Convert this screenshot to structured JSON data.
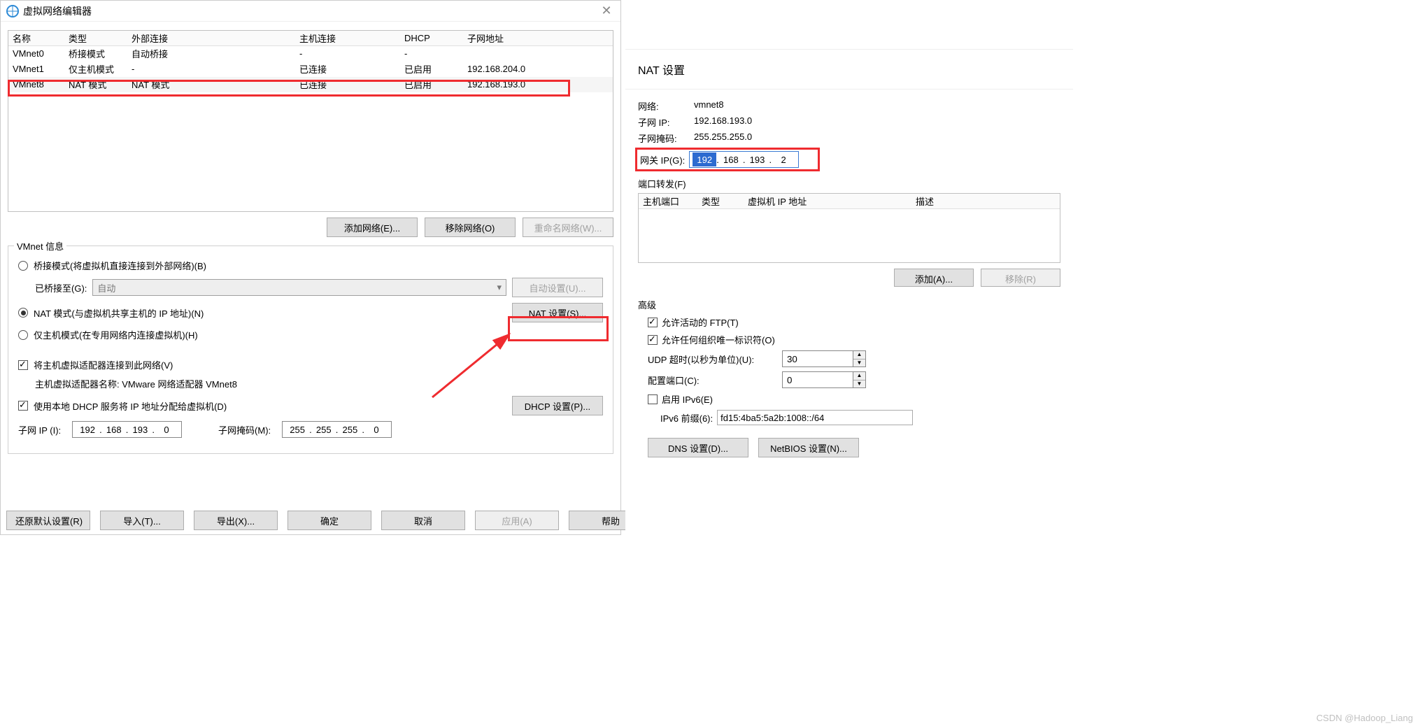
{
  "vne": {
    "title": "虚拟网络编辑器",
    "cols": {
      "name": "名称",
      "type": "类型",
      "ext": "外部连接",
      "host": "主机连接",
      "dhcp": "DHCP",
      "sub": "子网地址"
    },
    "rows": [
      {
        "name": "VMnet0",
        "type": "桥接模式",
        "ext": "自动桥接",
        "host": "-",
        "dhcp": "-",
        "sub": ""
      },
      {
        "name": "VMnet1",
        "type": "仅主机模式",
        "ext": "-",
        "host": "已连接",
        "dhcp": "已启用",
        "sub": "192.168.204.0"
      },
      {
        "name": "VMnet8",
        "type": "NAT 模式",
        "ext": "NAT 模式",
        "host": "已连接",
        "dhcp": "已启用",
        "sub": "192.168.193.0"
      }
    ],
    "btns": {
      "add": "添加网络(E)...",
      "remove": "移除网络(O)",
      "rename": "重命名网络(W)..."
    },
    "fs_title": "VMnet 信息",
    "mode_bridge": "桥接模式(将虚拟机直接连接到外部网络)(B)",
    "bridged_to_label": "已桥接至(G):",
    "bridged_to_value": "自动",
    "auto_set": "自动设置(U)...",
    "mode_nat": "NAT 模式(与虚拟机共享主机的 IP 地址)(N)",
    "nat_set": "NAT 设置(S)...",
    "mode_host": "仅主机模式(在专用网络内连接虚拟机)(H)",
    "chk_hostadapter": "将主机虚拟适配器连接到此网络(V)",
    "adapter_name": "主机虚拟适配器名称: VMware 网络适配器 VMnet8",
    "chk_dhcp": "使用本地 DHCP 服务将 IP 地址分配给虚拟机(D)",
    "dhcp_set": "DHCP 设置(P)...",
    "subnet_ip_label": "子网 IP (I):",
    "subnet_ip": [
      "192",
      "168",
      "193",
      "0"
    ],
    "subnet_mask_label": "子网掩码(M):",
    "subnet_mask": [
      "255",
      "255",
      "255",
      "0"
    ],
    "bottom": {
      "restore": "还原默认设置(R)",
      "import": "导入(T)...",
      "export": "导出(X)...",
      "ok": "确定",
      "cancel": "取消",
      "apply": "应用(A)",
      "help": "帮助"
    }
  },
  "nat": {
    "title": "NAT 设置",
    "kv": {
      "net_l": "网络:",
      "net_v": "vmnet8",
      "sub_l": "子网 IP:",
      "sub_v": "192.168.193.0",
      "mask_l": "子网掩码:",
      "mask_v": "255.255.255.0"
    },
    "gw_label": "网关 IP(G):",
    "gw": [
      "192",
      "168",
      "193",
      "2"
    ],
    "pf_title": "端口转发(F)",
    "pf_cols": {
      "hp": "主机端口",
      "type": "类型",
      "vip": "虚拟机 IP 地址",
      "desc": "描述"
    },
    "pf_btns": {
      "add": "添加(A)...",
      "remove": "移除(R)"
    },
    "adv_title": "高级",
    "adv": {
      "ftp": "允许活动的 FTP(T)",
      "oui": "允许任何组织唯一标识符(O)",
      "udp_l": "UDP 超时(以秒为单位)(U):",
      "udp_v": "30",
      "cfg_l": "配置端口(C):",
      "cfg_v": "0",
      "ipv6_chk": "启用 IPv6(E)",
      "ipv6_l": "IPv6 前缀(6):",
      "ipv6_v": "fd15:4ba5:5a2b:1008::/64"
    },
    "bottom": {
      "dns": "DNS 设置(D)...",
      "netbios": "NetBIOS 设置(N)..."
    }
  },
  "watermark": "CSDN @Hadoop_Liang"
}
